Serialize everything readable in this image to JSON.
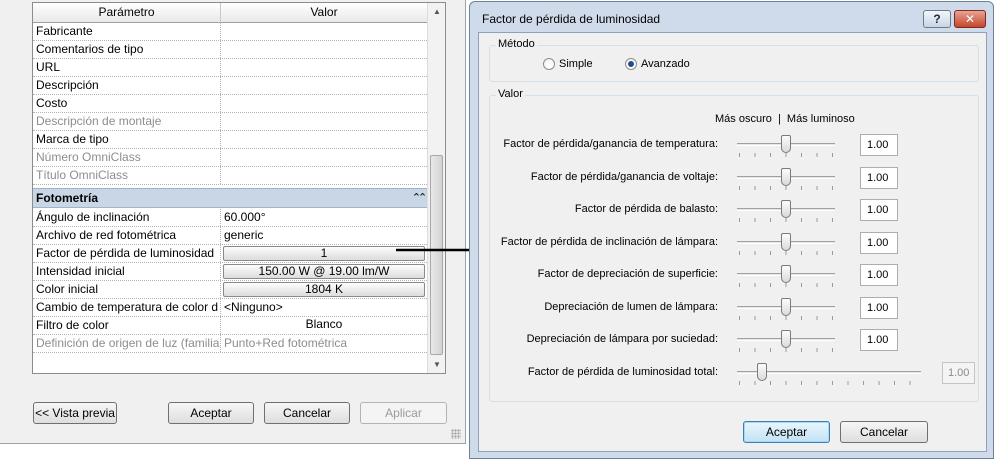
{
  "left_dialog": {
    "header": {
      "param": "Parámetro",
      "value": "Valor"
    },
    "rows_top": [
      {
        "name": "Fabricante",
        "value": "",
        "disabled": false
      },
      {
        "name": "Comentarios de tipo",
        "value": "",
        "disabled": false
      },
      {
        "name": "URL",
        "value": "",
        "disabled": false
      },
      {
        "name": "Descripción",
        "value": "",
        "disabled": false
      },
      {
        "name": "Costo",
        "value": "",
        "disabled": false
      },
      {
        "name": "Descripción de montaje",
        "value": "",
        "disabled": true
      },
      {
        "name": "Marca de tipo",
        "value": "",
        "disabled": false
      },
      {
        "name": "Número OmniClass",
        "value": "",
        "disabled": true
      },
      {
        "name": "Título OmniClass",
        "value": "",
        "disabled": true
      }
    ],
    "group": {
      "title": "Fotometría",
      "collapse_icon": "double-chevron-up-icon"
    },
    "rows_photometry": [
      {
        "name": "Ángulo de inclinación",
        "value": "60.000°",
        "kind": "text"
      },
      {
        "name": "Archivo de red fotométrica",
        "value": "generic",
        "kind": "text"
      },
      {
        "name": "Factor de pérdida de luminosidad",
        "value": "1",
        "kind": "button"
      },
      {
        "name": "Intensidad inicial",
        "value": "150.00 W @ 19.00 lm/W",
        "kind": "button"
      },
      {
        "name": "Color inicial",
        "value": "1804 K",
        "kind": "button"
      },
      {
        "name": "Cambio de temperatura de color d",
        "value": "<Ninguno>",
        "kind": "text"
      },
      {
        "name": "Filtro de color",
        "value": "Blanco",
        "kind": "plain-button"
      },
      {
        "name": "Definición de origen de luz (familia",
        "value": "Punto+Red fotométrica",
        "kind": "disabled"
      }
    ],
    "buttons": {
      "preview": "<< Vista previa",
      "ok": "Aceptar",
      "cancel": "Cancelar",
      "apply": "Aplicar"
    }
  },
  "right_dialog": {
    "title": "Factor de pérdida de luminosidad",
    "help_label": "?",
    "close_label": "✕",
    "method_group": "Método",
    "method_options": {
      "simple": "Simple",
      "advanced": "Avanzado"
    },
    "method_selected": "advanced",
    "value_group": "Valor",
    "scale_header": "Más oscuro  |  Más luminoso",
    "sliders": [
      {
        "label": "Factor de pérdida/ganancia de temperatura:",
        "value": "1.00",
        "position": 0.5
      },
      {
        "label": "Factor de pérdida/ganancia de voltaje:",
        "value": "1.00",
        "position": 0.5
      },
      {
        "label": "Factor de pérdida de balasto:",
        "value": "1.00",
        "position": 0.5
      },
      {
        "label": "Factor de pérdida de inclinación de lámpara:",
        "value": "1.00",
        "position": 0.5
      },
      {
        "label": "Factor de depreciación de superficie:",
        "value": "1.00",
        "position": 0.5
      },
      {
        "label": "Depreciación de lumen de lámpara:",
        "value": "1.00",
        "position": 0.5
      },
      {
        "label": "Depreciación de lámpara por suciedad:",
        "value": "1.00",
        "position": 0.5
      }
    ],
    "total": {
      "label": "Factor de pérdida de luminosidad total:",
      "value": "1.00",
      "position": 0.25
    },
    "buttons": {
      "ok": "Aceptar",
      "cancel": "Cancelar"
    }
  },
  "colors": {
    "group_header": "#c8d6e6",
    "window_frame": "#cfdbea",
    "close_button": "#c6452c",
    "arrow": "#000000"
  }
}
